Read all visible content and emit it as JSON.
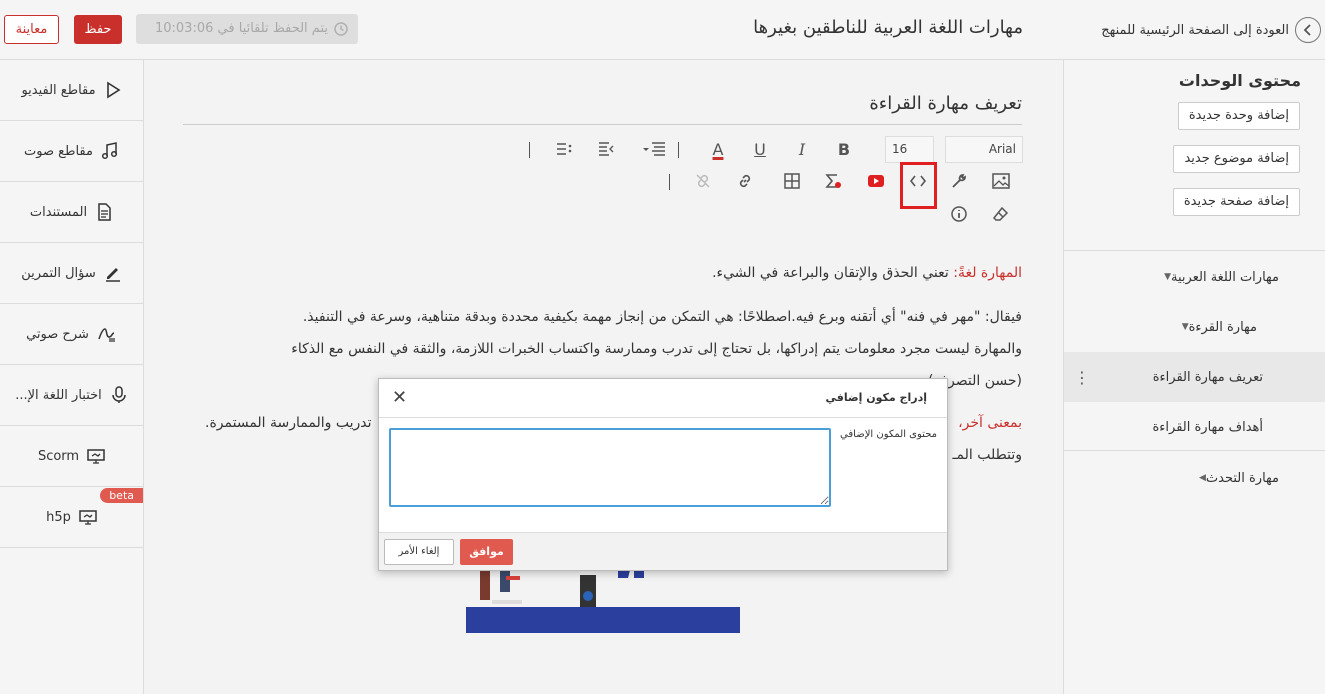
{
  "topbar": {
    "preview_label": "معاينة",
    "save_label": "حفظ",
    "autosave_text": "يتم الحفظ تلقائيا في 10:03:06",
    "course_title": "مهارات اللغة العربية للناطقين بغيرها",
    "back_label": "العودة إلى الصفحة الرئيسية للمنهج"
  },
  "left_sidebar": {
    "items": [
      {
        "label": "مقاطع الفيديو",
        "icon": "play-icon"
      },
      {
        "label": "مقاطع صوت",
        "icon": "music-icon"
      },
      {
        "label": "المستندات",
        "icon": "document-icon"
      },
      {
        "label": "سؤال التمرين",
        "icon": "pencil-icon"
      },
      {
        "label": "شرح صوتي",
        "icon": "audio-explain-icon"
      },
      {
        "label": "اختبار اللغة الإ...",
        "icon": "microphone-icon"
      },
      {
        "label": "Scorm",
        "icon": "monitor-icon"
      },
      {
        "label": "h5p",
        "icon": "monitor-icon",
        "badge": "beta"
      }
    ]
  },
  "right_sidebar": {
    "title": "محتوى الوحدات",
    "add_unit": "إضافة وحدة جديدة",
    "add_topic": "إضافة موضوع جديد",
    "add_page": "إضافة صفحة جديدة",
    "tree": [
      {
        "label": "مهارات اللغة العربية",
        "caret": "▼"
      },
      {
        "label": "مهارة القرءة",
        "caret": "▼"
      },
      {
        "label": "تعريف مهارة القراءة",
        "selected": true
      },
      {
        "label": "أهداف مهارة القراءة"
      },
      {
        "label": "مهارة التحدث",
        "caret": "◀"
      }
    ]
  },
  "editor": {
    "page_title": "تعريف مهارة القراءة",
    "font_family": "Arial",
    "font_size": "16",
    "para1_red": "المهارة لغةً:",
    "para1_rest": " تعني الحذق والإتقان والبراعة في الشيء.",
    "para2_line1": "فيقال: \"مهر في فنه\" أي أتقنه وبرع فيه.اصطلاحًا: هي التمكن من إنجاز مهمة بكيفية محددة وبدقة متناهية، وسرعة في التنفيذ.",
    "para2_line2": "والمهارة ليست مجرد معلومات يتم إدراكها، بل تحتاج إلى تدرب وممارسة واكتساب الخبرات اللازمة، والثقة في النفس مع الذكاء",
    "para2_line3": "(حسن التصرف).",
    "para3_red": "بمعنى آخر،",
    "para3_rest": "تدريب والممارسة المستمرة.",
    "para4": "وتتطلب المـ"
  },
  "dialog": {
    "title": "إدراج مكون إضافي",
    "close": "✕",
    "field_label": "محتوى المكون الإضافي",
    "ok_label": "موافق",
    "cancel_label": "إلغاء الأمر"
  }
}
